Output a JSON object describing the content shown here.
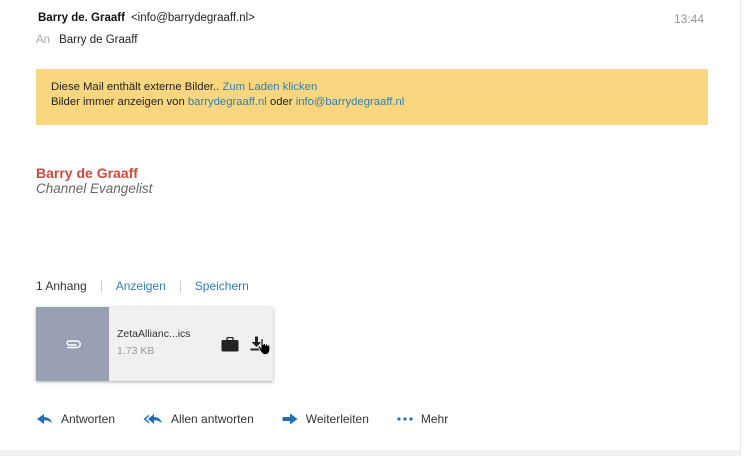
{
  "header": {
    "sender_name": "Barry de. Graaff",
    "sender_email": "<info@barrydegraaff.nl>",
    "time": "13:44",
    "recipient_label": "An",
    "recipient_name": "Barry de Graaff"
  },
  "banner": {
    "line1_text": "Diese Mail enthält externe Bilder..",
    "line1_link": "Zum Laden klicken",
    "line2_text": "Bilder immer anzeigen von",
    "line2_link1": "barrydegraaff.nl",
    "line2_mid": "oder",
    "line2_link2": "info@barrydegraaff.nl",
    "bg_color": "#fad67f",
    "link_color": "#2f7fb8"
  },
  "signature": {
    "name": "Barry de Graaff",
    "title": "Channel Evangelist",
    "name_color": "#d0493f"
  },
  "attachments": {
    "count_label": "1 Anhang",
    "view_label": "Anzeigen",
    "save_label": "Speichern",
    "file": {
      "name": "ZetaAllianc...ics",
      "size": "1.73 KB",
      "icon": "paperclip-icon"
    }
  },
  "actions": {
    "reply": "Antworten",
    "reply_all": "Allen antworten",
    "forward": "Weiterleiten",
    "more": "Mehr",
    "accent_color": "#1f6fb2"
  }
}
